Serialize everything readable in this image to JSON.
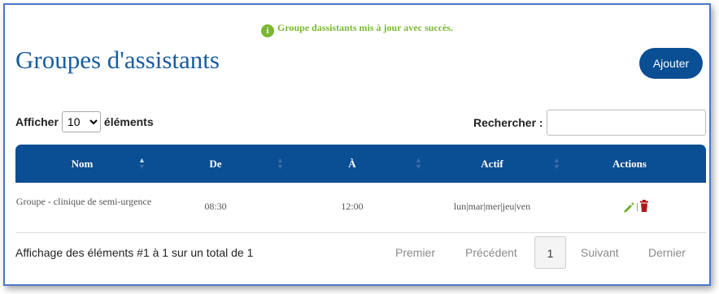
{
  "alert": {
    "icon": "info-icon",
    "text": "Groupe dassistants mis à jour avec succès.",
    "color": "#7ab833"
  },
  "page": {
    "title": "Groupes d'assistants",
    "add_label": "Ajouter"
  },
  "length": {
    "prefix": "Afficher",
    "value": "10",
    "suffix": "éléments"
  },
  "search": {
    "label": "Rechercher :",
    "value": ""
  },
  "table": {
    "columns": [
      "Nom",
      "De",
      "À",
      "Actif",
      "Actions"
    ],
    "rows": [
      {
        "nom": "Groupe - clinique de semi-urgence",
        "de": "08:30",
        "a": "12:00",
        "actif": "lun|mar|mer|jeu|ven",
        "actions": [
          "edit-icon",
          "delete-icon"
        ]
      }
    ]
  },
  "footer": {
    "info": "Affichage des éléments #1 à 1 sur un total de 1",
    "first": "Premier",
    "prev": "Précédent",
    "current": "1",
    "next": "Suivant",
    "last": "Dernier"
  },
  "colors": {
    "header": "#0a4e93",
    "title": "#1a5da0",
    "edit": "#6cae2e",
    "delete": "#b01818",
    "border": "#4a78c6"
  }
}
